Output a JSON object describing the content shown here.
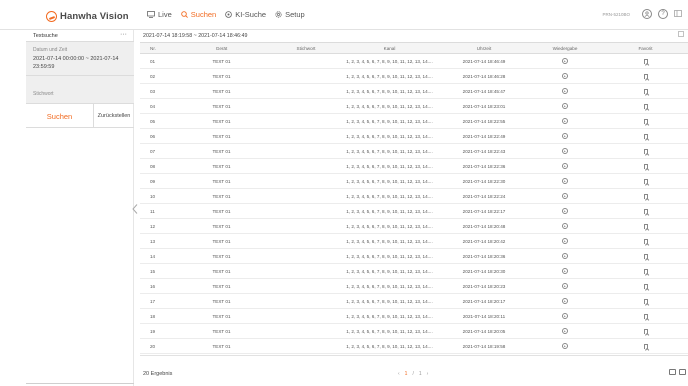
{
  "brand": {
    "name": "Hanwha Vision",
    "color": "#f26b21"
  },
  "nav": [
    {
      "label": "Live",
      "icon": "monitor-icon",
      "active": false
    },
    {
      "label": "Suchen",
      "icon": "search-icon",
      "active": true
    },
    {
      "label": "KI-Suche",
      "icon": "ai-search-icon",
      "active": false
    },
    {
      "label": "Setup",
      "icon": "gear-icon",
      "active": false
    }
  ],
  "header": {
    "model": "PRN-5210BO",
    "help_label": "?"
  },
  "left_panel": {
    "title": "Textsuche",
    "more": "···",
    "date_label": "Datum und Zeit",
    "date_value": "2021-07-14 00:00:00 ~ 2021-07-14 23:59:59",
    "keyword_label": "Stichwort",
    "search_button": "Suchen",
    "reset_button": "Zurückstellen"
  },
  "main": {
    "date_range": "2021-07-14 18:19:58 ~ 2021-07-14 18:46:49",
    "columns": [
      "Nr.",
      "Gerät",
      "Stichwort",
      "Kanal",
      "Uhrzeit",
      "Wiedergabe",
      "Favorit"
    ],
    "rows": [
      {
        "nr": "01",
        "device": "TEXT 01",
        "keyword": "",
        "channel": "1, 2, 3, 4, 5, 6, 7, 8, 9, 10, 11, 12, 13, 14....",
        "time": "2021-07-14 18:46:49"
      },
      {
        "nr": "02",
        "device": "TEXT 01",
        "keyword": "",
        "channel": "1, 2, 3, 4, 5, 6, 7, 8, 9, 10, 11, 12, 13, 14....",
        "time": "2021-07-14 18:46:28"
      },
      {
        "nr": "03",
        "device": "TEXT 01",
        "keyword": "",
        "channel": "1, 2, 3, 4, 5, 6, 7, 8, 9, 10, 11, 12, 13, 14....",
        "time": "2021-07-14 18:45:47"
      },
      {
        "nr": "04",
        "device": "TEXT 01",
        "keyword": "",
        "channel": "1, 2, 3, 4, 5, 6, 7, 8, 9, 10, 11, 12, 13, 14....",
        "time": "2021-07-14 18:23:01"
      },
      {
        "nr": "05",
        "device": "TEXT 01",
        "keyword": "",
        "channel": "1, 2, 3, 4, 5, 6, 7, 8, 9, 10, 11, 12, 13, 14....",
        "time": "2021-07-14 18:22:55"
      },
      {
        "nr": "06",
        "device": "TEXT 01",
        "keyword": "",
        "channel": "1, 2, 3, 4, 5, 6, 7, 8, 9, 10, 11, 12, 13, 14....",
        "time": "2021-07-14 18:22:49"
      },
      {
        "nr": "07",
        "device": "TEXT 01",
        "keyword": "",
        "channel": "1, 2, 3, 4, 5, 6, 7, 8, 9, 10, 11, 12, 13, 14....",
        "time": "2021-07-14 18:22:43"
      },
      {
        "nr": "08",
        "device": "TEXT 01",
        "keyword": "",
        "channel": "1, 2, 3, 4, 5, 6, 7, 8, 9, 10, 11, 12, 13, 14....",
        "time": "2021-07-14 18:22:36"
      },
      {
        "nr": "09",
        "device": "TEXT 01",
        "keyword": "",
        "channel": "1, 2, 3, 4, 5, 6, 7, 8, 9, 10, 11, 12, 13, 14....",
        "time": "2021-07-14 18:22:30"
      },
      {
        "nr": "10",
        "device": "TEXT 01",
        "keyword": "",
        "channel": "1, 2, 3, 4, 5, 6, 7, 8, 9, 10, 11, 12, 13, 14....",
        "time": "2021-07-14 18:22:24"
      },
      {
        "nr": "11",
        "device": "TEXT 01",
        "keyword": "",
        "channel": "1, 2, 3, 4, 5, 6, 7, 8, 9, 10, 11, 12, 13, 14....",
        "time": "2021-07-14 18:22:17"
      },
      {
        "nr": "12",
        "device": "TEXT 01",
        "keyword": "",
        "channel": "1, 2, 3, 4, 5, 6, 7, 8, 9, 10, 11, 12, 13, 14....",
        "time": "2021-07-14 18:20:48"
      },
      {
        "nr": "13",
        "device": "TEXT 01",
        "keyword": "",
        "channel": "1, 2, 3, 4, 5, 6, 7, 8, 9, 10, 11, 12, 13, 14....",
        "time": "2021-07-14 18:20:42"
      },
      {
        "nr": "14",
        "device": "TEXT 01",
        "keyword": "",
        "channel": "1, 2, 3, 4, 5, 6, 7, 8, 9, 10, 11, 12, 13, 14....",
        "time": "2021-07-14 18:20:36"
      },
      {
        "nr": "15",
        "device": "TEXT 01",
        "keyword": "",
        "channel": "1, 2, 3, 4, 5, 6, 7, 8, 9, 10, 11, 12, 13, 14....",
        "time": "2021-07-14 18:20:30"
      },
      {
        "nr": "16",
        "device": "TEXT 01",
        "keyword": "",
        "channel": "1, 2, 3, 4, 5, 6, 7, 8, 9, 10, 11, 12, 13, 14....",
        "time": "2021-07-14 18:20:23"
      },
      {
        "nr": "17",
        "device": "TEXT 01",
        "keyword": "",
        "channel": "1, 2, 3, 4, 5, 6, 7, 8, 9, 10, 11, 12, 13, 14....",
        "time": "2021-07-14 18:20:17"
      },
      {
        "nr": "18",
        "device": "TEXT 01",
        "keyword": "",
        "channel": "1, 2, 3, 4, 5, 6, 7, 8, 9, 10, 11, 12, 13, 14....",
        "time": "2021-07-14 18:20:11"
      },
      {
        "nr": "19",
        "device": "TEXT 01",
        "keyword": "",
        "channel": "1, 2, 3, 4, 5, 6, 7, 8, 9, 10, 11, 12, 13, 14....",
        "time": "2021-07-14 18:20:05"
      },
      {
        "nr": "20",
        "device": "TEXT 01",
        "keyword": "",
        "channel": "1, 2, 3, 4, 5, 6, 7, 8, 9, 10, 11, 12, 13, 14....",
        "time": "2021-07-14 18:19:58"
      }
    ],
    "result_count": "20 Ergebnis",
    "pager": {
      "prev": "‹",
      "current": "1",
      "separator": "/",
      "total": "1",
      "next": "›"
    }
  }
}
